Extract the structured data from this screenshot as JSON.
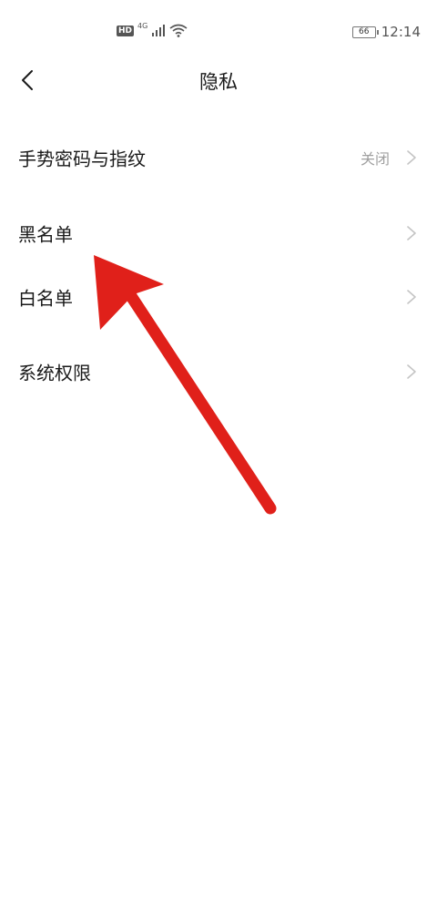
{
  "status_bar": {
    "hd_label": "HD",
    "network_label": "4G",
    "battery_level": "66",
    "time": "12:14",
    "icons": [
      "hd-icon",
      "signal-icon",
      "wifi-icon",
      "battery-icon"
    ]
  },
  "header": {
    "title": "隐私",
    "back_icon": "chevron-left-icon"
  },
  "settings": {
    "items": [
      {
        "label": "手势密码与指纹",
        "value": "关闭"
      },
      {
        "label": "黑名单",
        "value": ""
      },
      {
        "label": "白名单",
        "value": ""
      },
      {
        "label": "系统权限",
        "value": ""
      }
    ]
  },
  "annotation": {
    "arrow_color": "#e0201a",
    "target": "黑名单"
  },
  "colors": {
    "background": "#ffffff",
    "text_primary": "#1a1a1a",
    "text_secondary": "#a0a0a0",
    "chevron": "#c4c4c4"
  }
}
